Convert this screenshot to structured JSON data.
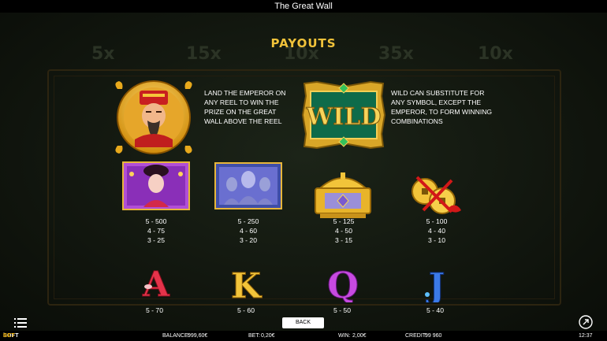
{
  "window": {
    "title": "The Great Wall"
  },
  "background": {
    "ghost_multipliers": [
      "5x",
      "15x",
      "10x",
      "35x",
      "10x"
    ]
  },
  "payouts": {
    "heading": "PAYOUTS",
    "emperor": {
      "icon": "emperor-icon",
      "description": "LAND THE EMPEROR ON ANY REEL TO WIN THE PRIZE ON THE GREAT WALL ABOVE THE REEL"
    },
    "wild": {
      "label": "WILD",
      "description": "WILD CAN SUBSTITUTE  FOR ANY SYMBOL, EXCEPT THE EMPEROR, TO FORM WINNING COMBINATIONS"
    },
    "symbols": [
      {
        "icon": "empress-icon",
        "pays": [
          "5 - 500",
          "4 - 75",
          "3 - 25"
        ]
      },
      {
        "icon": "terracotta-warriors-icon",
        "pays": [
          "5 - 250",
          "4 - 60",
          "3 - 20"
        ]
      },
      {
        "icon": "treasure-chest-icon",
        "pays": [
          "5 - 125",
          "4 - 50",
          "3 - 15"
        ]
      },
      {
        "icon": "gold-coins-icon",
        "pays": [
          "5 - 100",
          "4 - 40",
          "3 - 10"
        ]
      },
      {
        "icon": "letter-a-icon",
        "glyph": "A",
        "pays": [
          "5 - 70"
        ]
      },
      {
        "icon": "letter-k-icon",
        "glyph": "K",
        "pays": [
          "5 - 60"
        ]
      },
      {
        "icon": "letter-q-icon",
        "glyph": "Q",
        "pays": [
          "5 - 50"
        ]
      },
      {
        "icon": "letter-j-icon",
        "glyph": "J",
        "pays": [
          "5 - 40"
        ]
      }
    ]
  },
  "controls": {
    "back_label": "BACK",
    "menu_icon": "hamburger-menu-icon",
    "fullscreen_icon": "fullscreen-icon"
  },
  "statusbar": {
    "logo_prefix": "i",
    "logo_soft": "SOFT",
    "logo_bet": "BET",
    "balance_label": "BALANCE:",
    "balance_value": "999,60€",
    "bet_label": "BET:",
    "bet_value": "0,20€",
    "win_label": "WIN:",
    "win_value": "2,00€",
    "credit_label": "CREDIT:",
    "credit_value": "99 960",
    "clock": "12:37"
  },
  "colors": {
    "gold": "#f0c23a",
    "bet_orange": "#f2b000",
    "wild_green": "#0e6b4a",
    "empress_purple": "#b14fd6"
  }
}
